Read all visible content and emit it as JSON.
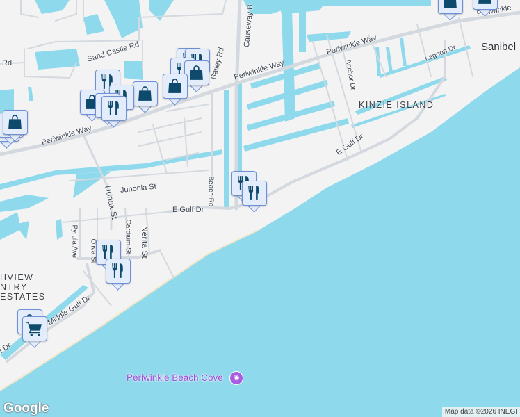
{
  "map": {
    "colors": {
      "land": "#f4f3f4",
      "water": "#8edaec",
      "road": "#d3d9de",
      "pin_bg": "#e3ecfb",
      "pin_border": "#6f90d6",
      "pin_icon": "#0d4a6b",
      "poi": "#9b4fd8"
    },
    "road_labels": [
      "Sand Castle Rd",
      "Rd",
      "Bailey Rd",
      "Causeway B",
      "Periwinkle Way",
      "Periwinkle Way",
      "Periwinkle Way",
      "Periwinkle",
      "Anchor Dr",
      "Lagoon Dr",
      "Beach Rd",
      "Junonia St",
      "Donax St",
      "E Gulf Dr",
      "E Gulf Dr",
      "Pyrula Ave",
      "Oliva St",
      "Cardium St",
      "Nerita St",
      "Middle Gulf Dr",
      "f Dr"
    ],
    "area_labels": [
      "KINZIE ISLAND",
      "HVIEW\nNTRY\nESTATES"
    ],
    "city_label": "Sanibel",
    "poi": {
      "name": "Periwinkle Beach Cove",
      "icon": "camera-icon"
    },
    "pins": [
      "restaurant",
      "restaurant",
      "restaurant",
      "shopping",
      "shopping",
      "shopping",
      "restaurant",
      "restaurant",
      "shopping",
      "restaurant",
      "restaurant",
      "shopping",
      "shopping",
      "shopping",
      "shopping",
      "shopping",
      "restaurant",
      "restaurant",
      "restaurant",
      "restaurant",
      "shopping",
      "grocery"
    ],
    "logo": "Google",
    "attribution": "Map data ©2026 INEGI"
  }
}
